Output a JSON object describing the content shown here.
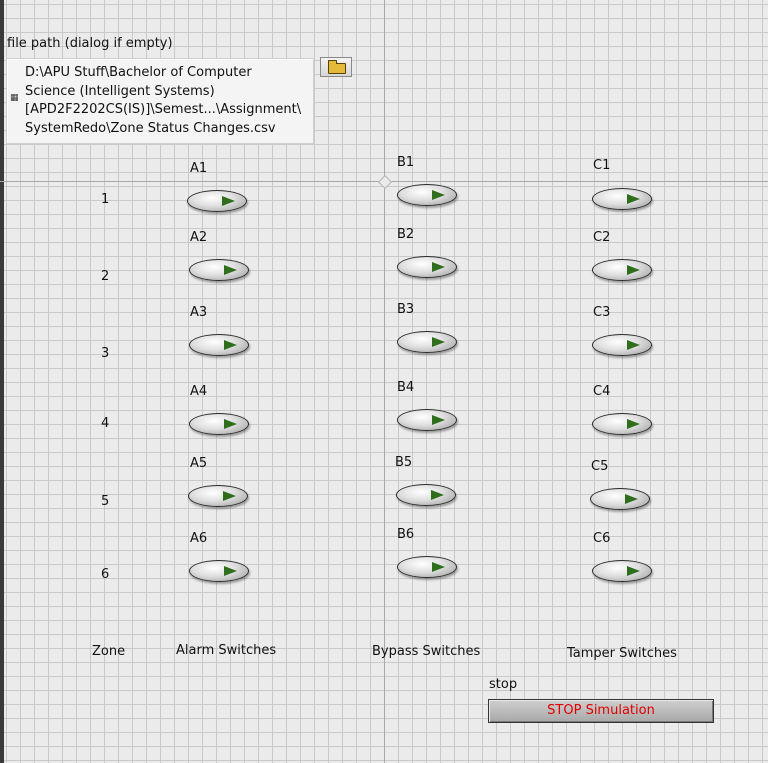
{
  "file_path": {
    "label": "file path (dialog if empty)",
    "value": "D:\\APU Stuff\\Bachelor of Computer\nScience (Intelligent Systems)\n[APD2F2202CS(IS)]\\Semest...\\Assignment\\\nSystemRedo\\Zone Status Changes.csv",
    "browse_icon": "folder-open-icon"
  },
  "zones": [
    "1",
    "2",
    "3",
    "4",
    "5",
    "6"
  ],
  "alarm_switches": [
    "A1",
    "A2",
    "A3",
    "A4",
    "A5",
    "A6"
  ],
  "bypass_switches": [
    "B1",
    "B2",
    "B3",
    "B4",
    "B5",
    "B6"
  ],
  "tamper_switches": [
    "C1",
    "C2",
    "C3",
    "C4",
    "C5",
    "C6"
  ],
  "column_headers": {
    "zone": "Zone",
    "alarm": "Alarm Switches",
    "bypass": "Bypass Switches",
    "tamper": "Tamper Switches"
  },
  "stop": {
    "label": "stop",
    "button_text": "STOP Simulation",
    "text_color": "#e00000"
  },
  "colors": {
    "led_arrow": "#2f6e1d",
    "background": "#ebebeb",
    "grid": "#c9c9c9"
  }
}
